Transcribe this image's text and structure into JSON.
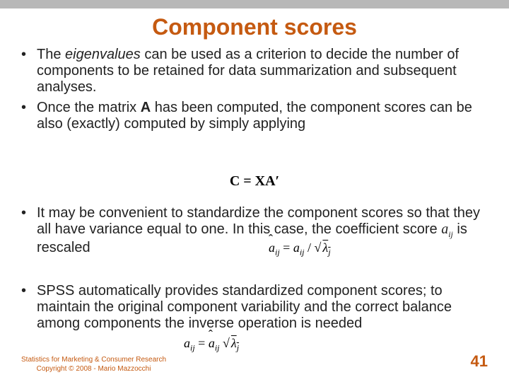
{
  "title": "Component scores",
  "bullets": {
    "b1": {
      "t1": "The ",
      "em": "eigenvalues",
      "t2": " can be used as a criterion to decide the number of components to be retained for data summarization and subsequent analyses."
    },
    "b2": {
      "t1": "Once the matrix ",
      "bold": "A",
      "t2": " has been computed, the component scores can be also (exactly) computed by simply applying"
    },
    "b3": {
      "t1": "It may be convenient to standardize the component scores so that they all have variance equal to one. In this case, the coefficient score ",
      "var": "a",
      "sub": "ij",
      "t2": " is rescaled"
    },
    "b4": "SPSS automatically provides standardized component scores; to maintain the original component variability and the correct balance among components the inverse operation is needed"
  },
  "equations": {
    "eq1": "C = XA′",
    "eq2": {
      "a": "a",
      "ij": "ij",
      "eq": " = ",
      "div": " / ",
      "lam": "λ",
      "j": "j"
    },
    "eq3": {
      "a": "a",
      "ij": "ij",
      "eq": " = ",
      "lam": "λ",
      "j": "j"
    }
  },
  "footer": {
    "l1": "Statistics for Marketing & Consumer Research",
    "l2": "Copyright © 2008 - Mario Mazzocchi"
  },
  "pagenum": "41"
}
